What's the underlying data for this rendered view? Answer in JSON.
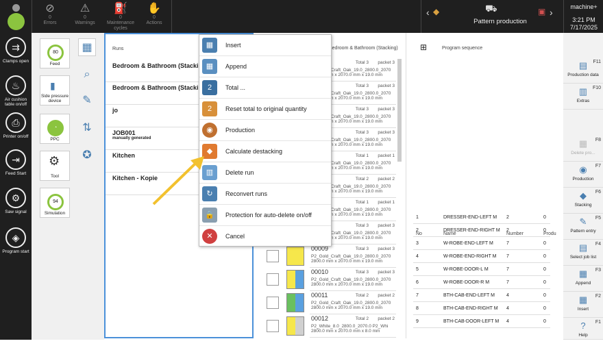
{
  "topbar": {
    "errors": {
      "count": "0",
      "label": "Errors"
    },
    "warnings": {
      "count": "0",
      "label": "Warnings"
    },
    "maintenance": {
      "count": "0",
      "label": "Maintenance cycles"
    },
    "actions": {
      "count": "0",
      "label": "Actions"
    },
    "production_title": "Pattern production",
    "machine": "machine+",
    "time": "3:21 PM",
    "date": "7/17/2025"
  },
  "sidebar": [
    {
      "label": "Clamps open",
      "icon": "clamp-icon"
    },
    {
      "label": "Air cushion table on/off",
      "icon": "air-cushion-icon"
    },
    {
      "label": "Printer on/off",
      "icon": "printer-icon"
    },
    {
      "label": "Feed Start",
      "icon": "feed-start-icon"
    },
    {
      "label": "Saw signal",
      "icon": "saw-signal-icon"
    },
    {
      "label": "Program start",
      "icon": "program-start-icon"
    }
  ],
  "tools": {
    "feed": {
      "value": "80",
      "label": "Feed"
    },
    "side_pressure": "Side pressure device",
    "ppc": "PPC",
    "tool": "Tool",
    "simulation": {
      "value": "94",
      "label": "Simulation"
    }
  },
  "runs": {
    "header": "Runs",
    "items": [
      {
        "name": "Bedroom & Bathroom (Stacking)",
        "sub": ""
      },
      {
        "name": "Bedroom & Bathroom (Stacking)",
        "sub": ""
      },
      {
        "name": "jo",
        "sub": ""
      },
      {
        "name": "JOB001",
        "sub": "manually generated"
      },
      {
        "name": "Kitchen",
        "sub": ""
      },
      {
        "name": "Kitchen - Kopie",
        "sub": ""
      }
    ]
  },
  "context_menu": [
    "Insert",
    "Append",
    "Total ...",
    "Reset total to original quantity",
    "Production",
    "Calculate destacking",
    "Delete run",
    "Reconvert runs",
    "Protection for auto-delete on/off",
    "Cancel"
  ],
  "packets": {
    "header": "Bedroom & Bathroom (Stacking)",
    "items": [
      {
        "num": "",
        "total": "Total 3",
        "packet": "packet 3",
        "name": "P2_Gold_Craft_Oak_19.0_2800.0_2070",
        "dim": "2800.0 mm x 2070.0 mm x 19.0 mm"
      },
      {
        "num": "",
        "total": "Total 3",
        "packet": "packet 3",
        "name": "P2_Gold_Craft_Oak_19.0_2800.0_2070",
        "dim": "2800.0 mm x 2070.0 mm x 19.0 mm"
      },
      {
        "num": "",
        "total": "Total 3",
        "packet": "packet 3",
        "name": "P2_Gold_Craft_Oak_19.0_2800.0_2070",
        "dim": "2800.0 mm x 2070.0 mm x 19.0 mm"
      },
      {
        "num": "",
        "total": "Total 3",
        "packet": "packet 3",
        "name": "P2_Gold_Craft_Oak_19.0_2800.0_2070",
        "dim": "2800.0 mm x 2070.0 mm x 19.0 mm"
      },
      {
        "num": "",
        "total": "Total 1",
        "packet": "packet 1",
        "name": "P2_Gold_Craft_Oak_19.0_2800.0_2070",
        "dim": "2800.0 mm x 2070.0 mm x 19.0 mm"
      },
      {
        "num": "",
        "total": "Total 2",
        "packet": "packet 2",
        "name": "P2_Gold_Craft_Oak_19.0_2800.0_2070",
        "dim": "2800.0 mm x 2070.0 mm x 19.0 mm"
      },
      {
        "num": "",
        "total": "Total 1",
        "packet": "packet 1",
        "name": "P2_Gold_Craft_Oak_19.0_2800.0_2070",
        "dim": "2800.0 mm x 2070.0 mm x 19.0 mm"
      },
      {
        "num": "",
        "total": "Total 3",
        "packet": "packet 3",
        "name": "P2_Gold_Craft_Oak_19.0_2800.0_2070",
        "dim": "2800.0 mm x 2070.0 mm x 19.0 mm"
      },
      {
        "num": "00009",
        "total": "Total 3",
        "packet": "packet 3",
        "name": "P2_Gold_Craft_Oak_19.0_2800.0_2070",
        "dim": "2800.0 mm x 2070.0 mm x 19.0 mm"
      },
      {
        "num": "00010",
        "total": "Total 3",
        "packet": "packet 3",
        "name": "P2_Gold_Craft_Oak_19.0_2800.0_2070",
        "dim": "2800.0 mm x 2070.0 mm x 19.0 mm"
      },
      {
        "num": "00011",
        "total": "Total 2",
        "packet": "packet 2",
        "name": "P2_Gold_Craft_Oak_19.0_2800.0_2070",
        "dim": "2800.0 mm x 2070.0 mm x 19.0 mm"
      },
      {
        "num": "00012",
        "total": "Total 2",
        "packet": "packet 2",
        "name": "P2_White_8.0_2800.0_2070.0 P2_Whi",
        "dim": "2800.0 mm x 2070.0 mm x 8.0 mm"
      }
    ]
  },
  "sequence": {
    "header": "Program sequence",
    "columns": [
      "No",
      "Name",
      "Number",
      "Produ"
    ],
    "rows": [
      {
        "no": "1",
        "name": "DRESSER-END-LEFT M",
        "number": "2",
        "prod": "0"
      },
      {
        "no": "2",
        "name": "DRESSER-END-RIGHT M",
        "number": "2",
        "prod": "0"
      },
      {
        "no": "3",
        "name": "W-ROBE-END-LEFT M",
        "number": "7",
        "prod": "0"
      },
      {
        "no": "4",
        "name": "W-ROBE-END-RIGHT M",
        "number": "7",
        "prod": "0"
      },
      {
        "no": "5",
        "name": "W-ROBE-DOOR-L M",
        "number": "7",
        "prod": "0"
      },
      {
        "no": "6",
        "name": "W-ROBE-DOOR-R M",
        "number": "7",
        "prod": "0"
      },
      {
        "no": "7",
        "name": "BTH-CAB-END-LEFT M",
        "number": "4",
        "prod": "0"
      },
      {
        "no": "8",
        "name": "BTH-CAB-END-RIGHT M",
        "number": "4",
        "prod": "0"
      },
      {
        "no": "9",
        "name": "BTH-CAB-DOOR-LEFT M",
        "number": "4",
        "prod": "0"
      }
    ]
  },
  "right_bar": [
    {
      "fk": "F11",
      "label": "Production data"
    },
    {
      "fk": "F10",
      "label": "Extras"
    },
    {
      "fk": "F8",
      "label": "Delete pro..."
    },
    {
      "fk": "F7",
      "label": "Production"
    },
    {
      "fk": "F6",
      "label": "Stacking"
    },
    {
      "fk": "F5",
      "label": "Pattern entry"
    },
    {
      "fk": "F4",
      "label": "Select job list"
    },
    {
      "fk": "F3",
      "label": "Append"
    },
    {
      "fk": "F2",
      "label": "Insert"
    },
    {
      "fk": "F1",
      "label": "Help"
    }
  ]
}
